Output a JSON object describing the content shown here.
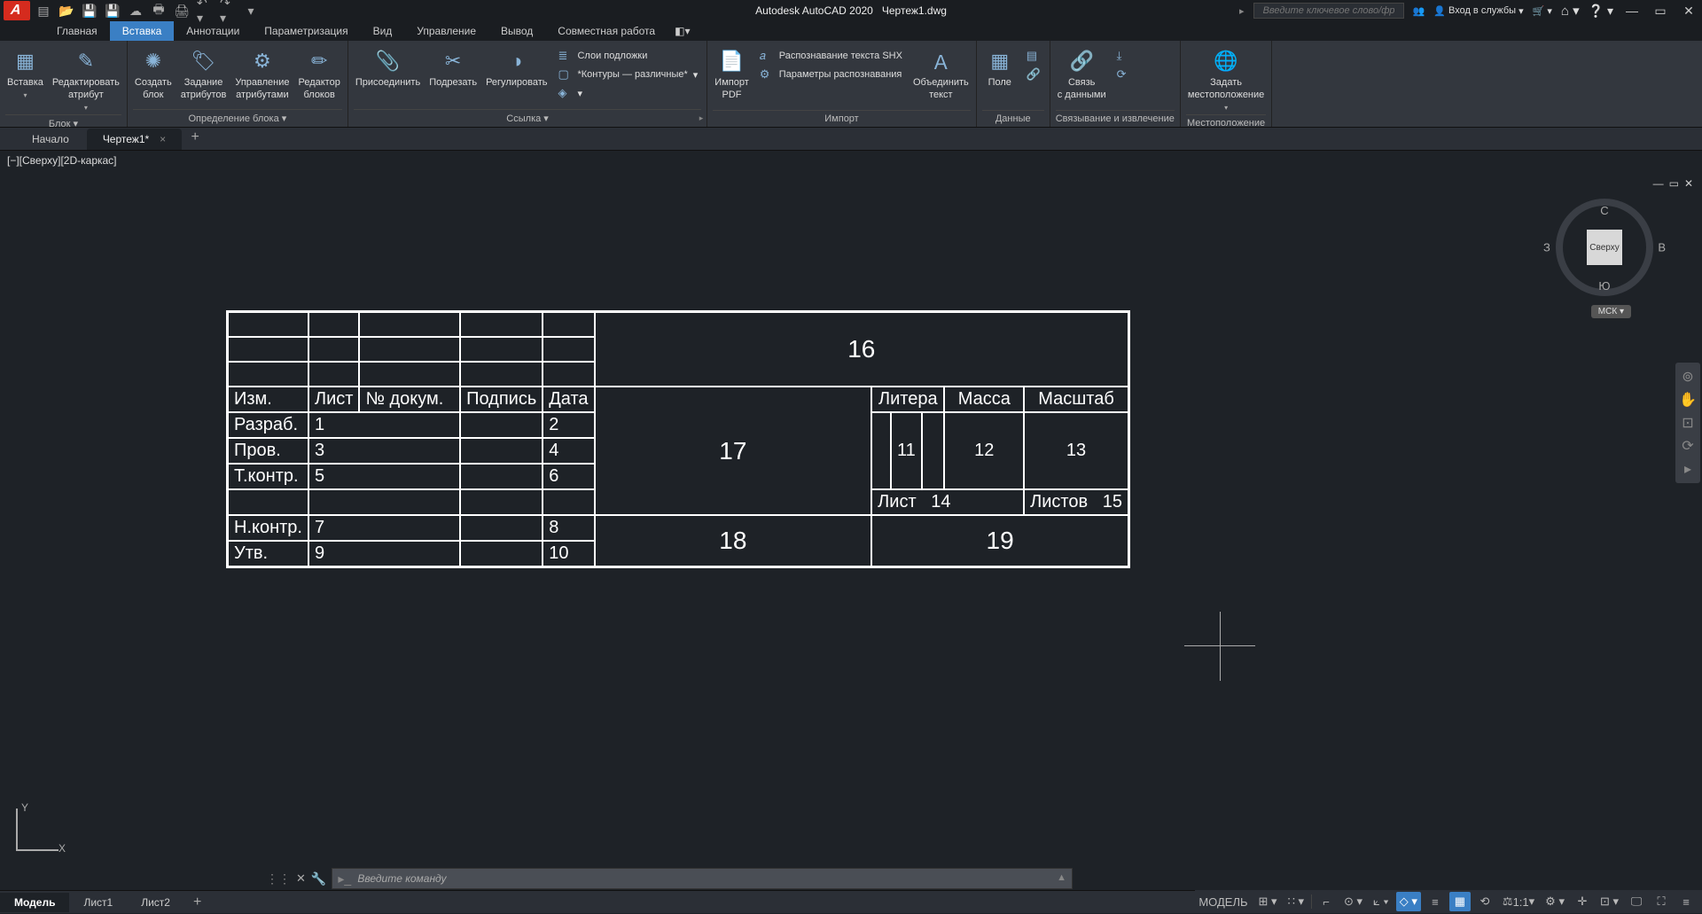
{
  "title": {
    "app": "Autodesk AutoCAD 2020",
    "file": "Чертеж1.dwg"
  },
  "search_placeholder": "Введите ключевое слово/фразу",
  "login_label": "Вход в службы",
  "ribbon_tabs": [
    "Главная",
    "Вставка",
    "Аннотации",
    "Параметризация",
    "Вид",
    "Управление",
    "Вывод",
    "Совместная работа"
  ],
  "ribbon_active_tab": "Вставка",
  "panels": {
    "block": {
      "title": "Блок",
      "insert": "Вставка",
      "edit_attr": "Редактировать\nатрибут"
    },
    "blockdef": {
      "title": "Определение блока",
      "create": "Создать\nблок",
      "attr": "Задание\nатрибутов",
      "manage": "Управление\nатрибутами",
      "editor": "Редактор\nблоков"
    },
    "ref": {
      "title": "Ссылка",
      "attach": "Присоединить",
      "clip": "Подрезать",
      "adjust": "Регулировать",
      "underlay": "Слои подложки",
      "frames": "*Контуры — различные*"
    },
    "import": {
      "title": "Импорт",
      "pdf": "Импорт\nPDF",
      "shx": "Распознавание текста SHX",
      "params": "Параметры распознавания",
      "combine": "Объединить\nтекст"
    },
    "data": {
      "title": "Данные",
      "field": "Поле"
    },
    "link": {
      "title": "Связывание и извлечение",
      "link": "Связь\nс данными"
    },
    "loc": {
      "title": "Местоположение",
      "set": "Задать\nместоположение"
    }
  },
  "file_tabs": {
    "start": "Начало",
    "current": "Чертеж1*",
    "close": "×",
    "plus": "+"
  },
  "viewport_label": "[−][Сверху][2D-каркас]",
  "viewcube": {
    "face": "Сверху",
    "n": "С",
    "s": "Ю",
    "w": "З",
    "e": "В",
    "wcs": "МСК"
  },
  "table": {
    "izm": "Изм.",
    "list": "Лист",
    "doc": "№ докум.",
    "sign": "Подпись",
    "date": "Дата",
    "rows": [
      {
        "role": "Разраб.",
        "a": "1",
        "b": "2"
      },
      {
        "role": "Пров.",
        "a": "3",
        "b": "4"
      },
      {
        "role": "Т.контр.",
        "a": "5",
        "b": "6"
      },
      {
        "role": "Н.контр.",
        "a": "7",
        "b": "8"
      },
      {
        "role": "Утв.",
        "a": "9",
        "b": "10"
      }
    ],
    "c16": "16",
    "c17": "17",
    "c18": "18",
    "c19": "19",
    "litera": "Литера",
    "mass": "Масса",
    "scale": "Масштаб",
    "c11": "11",
    "c12": "12",
    "c13": "13",
    "list_lbl": "Лист",
    "c14": "14",
    "lists_lbl": "Листов",
    "c15": "15"
  },
  "cmd_placeholder": "Введите команду",
  "layout_tabs": {
    "model": "Модель",
    "l1": "Лист1",
    "l2": "Лист2"
  },
  "status": {
    "model": "МОДЕЛЬ",
    "scale": "1:1"
  }
}
